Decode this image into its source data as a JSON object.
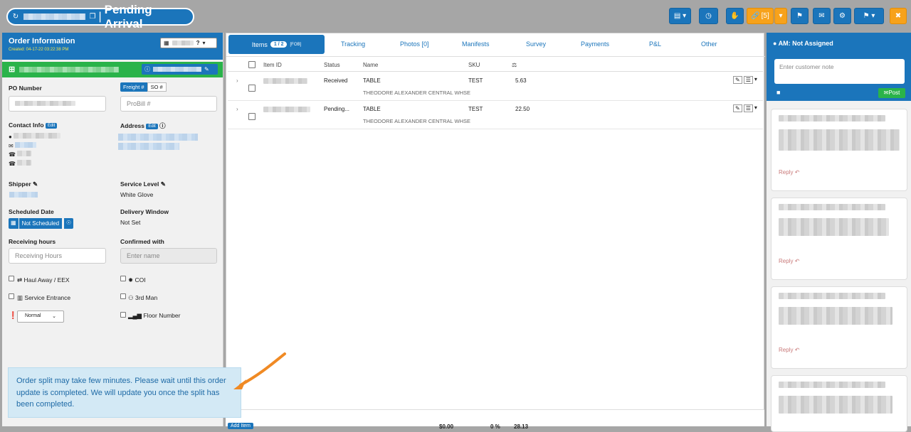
{
  "header": {
    "title": "Pending Arrival",
    "link_button_count": "[5]"
  },
  "order": {
    "heading": "Order Information",
    "created": "Created: 04-17-22 03:22:38 PM"
  },
  "form": {
    "po_label": "PO Number",
    "freight_btn": "Freight #",
    "so_btn": "SO #",
    "probill_placeholder": "ProBill #",
    "contact_label": "Contact Info",
    "edit": "Edit",
    "address_label": "Address",
    "shipper_label": "Shipper",
    "service_level_label": "Service Level",
    "service_level_value": "White Glove",
    "scheduled_date_label": "Scheduled Date",
    "not_scheduled": "Not Scheduled",
    "delivery_window_label": "Delivery Window",
    "delivery_window_value": "Not Set",
    "receiving_hours_label": "Receiving hours",
    "receiving_hours_placeholder": "Receiving Hours",
    "confirmed_with_label": "Confirmed with",
    "confirmed_with_placeholder": "Enter name",
    "haul_away": "Haul Away / EEX",
    "coi": "COI",
    "service_entrance": "Service Entrance",
    "third_man": "3rd Man",
    "priority_value": "Normal",
    "floor_number": "Floor Number"
  },
  "tabs": {
    "items": "Items",
    "items_badge": "1 / 2",
    "items_sup": "[FOB]",
    "tracking": "Tracking",
    "photos": "Photos [0]",
    "manifests": "Manifests",
    "survey": "Survey",
    "payments": "Payments",
    "pl": "P&L",
    "other": "Other"
  },
  "table": {
    "headers": {
      "item_id": "Item ID",
      "status": "Status",
      "name": "Name",
      "sku": "SKU"
    },
    "rows": [
      {
        "status": "Received",
        "name": "TABLE",
        "sku": "TEST",
        "weight": "5.63",
        "warehouse": "THEODORE ALEXANDER CENTRAL WHSE"
      },
      {
        "status": "Pending...",
        "name": "TABLE",
        "sku": "TEST",
        "weight": "22.50",
        "warehouse": "THEODORE ALEXANDER CENTRAL WHSE"
      }
    ]
  },
  "right": {
    "am": "AM: Not Assigned",
    "note_placeholder": "Enter customer note",
    "post": "Post",
    "reply": "Reply"
  },
  "toast": {
    "message": "Order split may take few minutes. Please wait until this order update is completed. We will update you once the split has been completed."
  },
  "footer": {
    "add_item": "Add Item",
    "total": "$0.00",
    "percent": "0 %",
    "weight": "28.13"
  },
  "colors": {
    "primary": "#1b75bb",
    "accent": "#f7a21b",
    "success": "#2ab34a"
  }
}
